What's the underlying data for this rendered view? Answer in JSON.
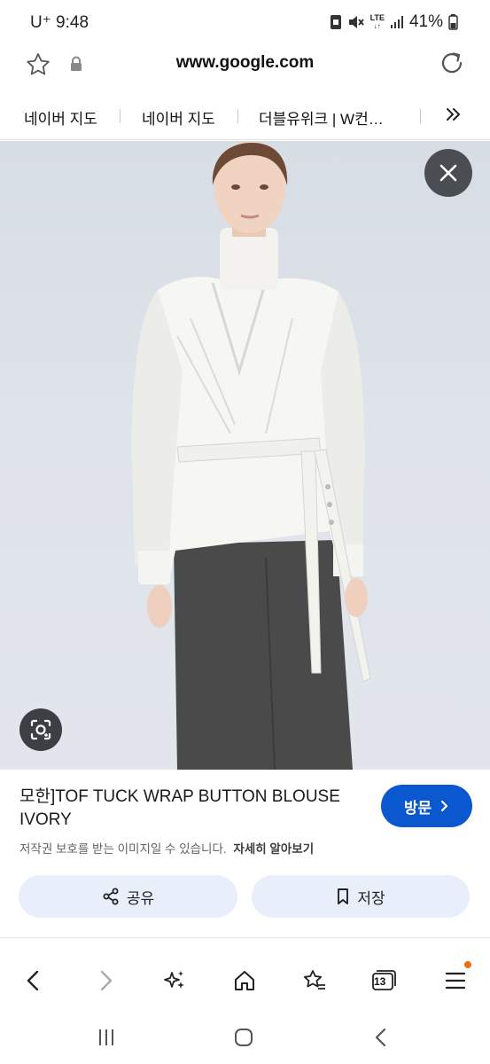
{
  "status_bar": {
    "carrier": "U⁺",
    "time": "9:48",
    "network": "LTE",
    "battery": "41%"
  },
  "url_bar": {
    "url": "www.google.com"
  },
  "bookmarks": [
    {
      "label": "네이버 지도"
    },
    {
      "label": "네이버 지도"
    },
    {
      "label": "더블유위크 | W컨…"
    }
  ],
  "result": {
    "title": "모한]TOF TUCK WRAP BUTTON BLOUSE IVORY",
    "visit_label": "방문",
    "copyright_notice": "저작권 보호를 받는 이미지일 수 있습니다.",
    "learn_more": "자세히 알아보기",
    "share_label": "공유",
    "save_label": "저장"
  },
  "toolbar": {
    "tabs_count": "13"
  },
  "colors": {
    "accent": "#0b57d0",
    "action_button_bg": "#e8effb",
    "notification_dot": "#e8710a"
  },
  "icons": [
    "star-icon",
    "lock-icon",
    "reload-icon",
    "close-icon",
    "lens-icon",
    "share-icon",
    "bookmark-icon",
    "back-icon",
    "forward-icon",
    "sparkle-icon",
    "home-icon",
    "bookmarks-star-icon",
    "tabs-icon",
    "menu-icon",
    "recents-icon",
    "home-nav-icon",
    "back-nav-icon"
  ]
}
